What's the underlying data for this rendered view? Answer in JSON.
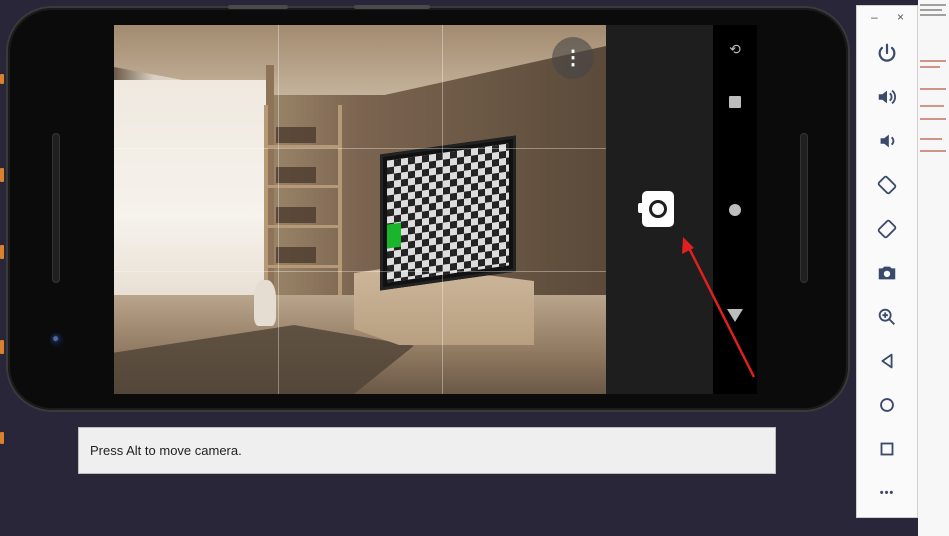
{
  "viewfinder": {
    "overflow_label": "⋮"
  },
  "nav": {
    "rotate_label": "⟲"
  },
  "hint": {
    "text": "Press Alt to move camera."
  },
  "sidebar": {
    "minimize": "–",
    "close": "×",
    "more_label": "•••"
  },
  "colors": {
    "annotation_arrow": "#e02020",
    "sidebar_icon": "#3a4a6b"
  }
}
